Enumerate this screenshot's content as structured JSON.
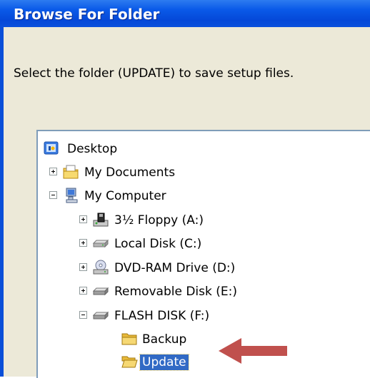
{
  "window": {
    "title": "Browse For Folder"
  },
  "dialog": {
    "prompt": "Select the folder (UPDATE) to save setup files."
  },
  "tree": {
    "desktop": "Desktop",
    "my_documents": "My Documents",
    "my_computer": "My Computer",
    "floppy": "3½ Floppy (A:)",
    "local_disk": "Local Disk (C:)",
    "dvd": "DVD-RAM Drive (D:)",
    "removable": "Removable Disk (E:)",
    "flash": "FLASH DISK (F:)",
    "backup": "Backup",
    "update": "Update"
  },
  "colors": {
    "title_bar": "#0A5AE8",
    "selection": "#316AC5",
    "arrow": "#C0504D"
  }
}
